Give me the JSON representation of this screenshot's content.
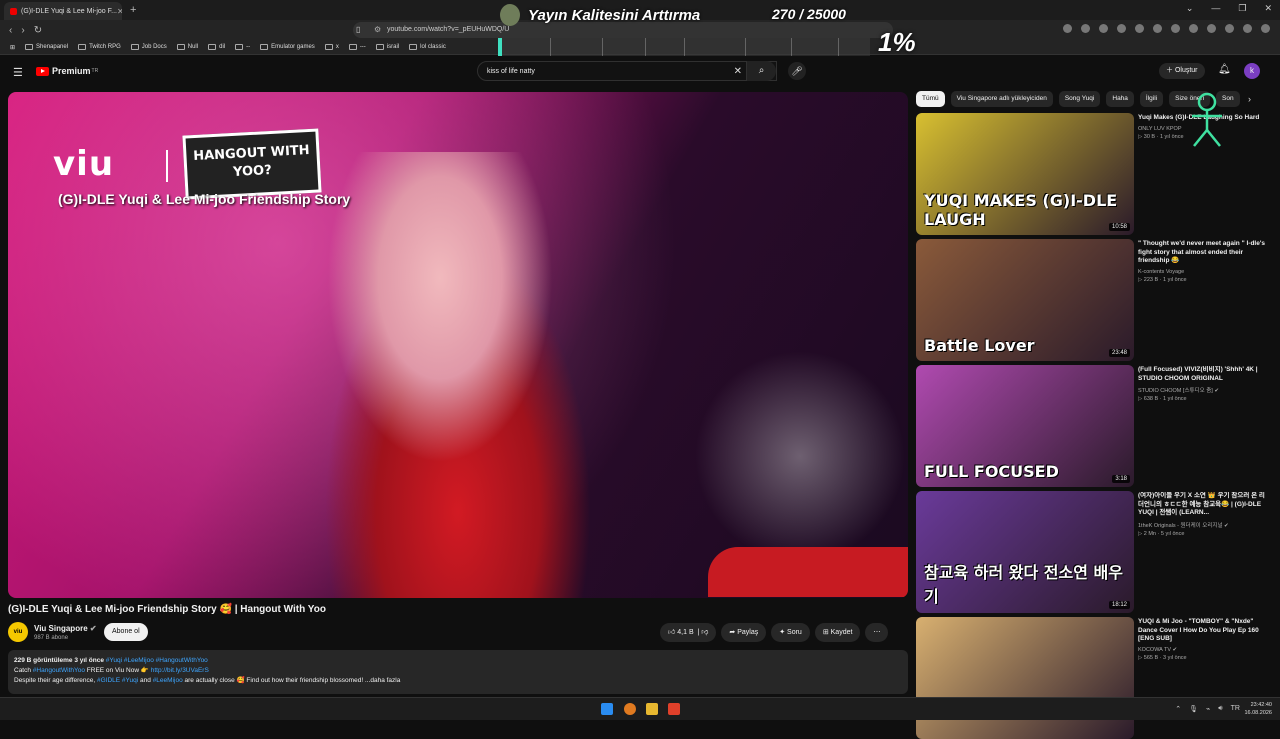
{
  "browser": {
    "tab_title": "(G)I-DLE Yuqi & Lee Mi-joo F...",
    "url": "youtube.com/watch?v=_pEUHuWDQ/U",
    "bookmarks": [
      "Shenapanel",
      "Twitch RPG",
      "Job Docs",
      "Null",
      "dil",
      "--",
      "Emulator games",
      "x",
      "---",
      "israil",
      "lol classic"
    ]
  },
  "stream_overlay": {
    "title": "Yayın Kalitesini Arttırma",
    "count": "270 / 25000",
    "percent": "1%",
    "progress": 0.01
  },
  "youtube": {
    "logo": "Premium",
    "logo_badge": "TR",
    "search_value": "kiss of life natty",
    "create_label": "Oluştur",
    "avatar_letter": "k"
  },
  "player": {
    "brand": "viu",
    "show_badge": "HANGOUT WITH YOO?",
    "overlay_text": "(G)I-DLE Yuqi & Lee Mi-joo Friendship Story"
  },
  "video": {
    "title": "(G)I-DLE Yuqi & Lee Mi-joo Friendship Story 🥰 | Hangout With Yoo",
    "channel": "Viu Singapore",
    "channel_avatar": "viu",
    "subs": "987 B abone",
    "subscribe": "Abone ol",
    "likes": "4,1 B",
    "share": "Paylaş",
    "ask": "Soru",
    "save": "Kaydet",
    "more": "⋯"
  },
  "description": {
    "views": "229 B görüntüleme  3 yıl önce",
    "tags": "#Yuqi #LeeMijoo #HangoutWithYoo",
    "line2_a": "Catch",
    "line2_tag": "#HangoutWithYoo",
    "line2_b": "FREE on Viu Now 👉",
    "line2_link": "http://bit.ly/3UVaErS",
    "line3_a": "Despite their age difference,",
    "line3_tags": "#GIDLE #Yuqi",
    "line3_b": "and",
    "line3_tag2": "#LeeMijoo",
    "line3_c": "are actually close 🥰 Find out how their friendship blossomed! ...daha fazla"
  },
  "chips": [
    "Tümü",
    "Viu Singapore adlı yükleyiciden",
    "Song Yuqi",
    "Haha",
    "İlgili",
    "Size öneri",
    "Son"
  ],
  "recommendations": [
    {
      "title": "Yuqi Makes (G)I-DLE Laughing So Hard",
      "channel": "ONLY LUV KPOP",
      "meta": "▷ 30 B · 1 yıl önce",
      "duration": "10:58",
      "thumb_text": "YUQI MAKES (G)I-DLE LAUGH",
      "color": "#d8c030"
    },
    {
      "title": "\" Thought we'd never meet again \" I-dle's fight story that almost ended their friendship 😂",
      "channel": "K-contents Voyage",
      "meta": "▷ 223 B · 1 yıl önce",
      "duration": "23:48",
      "thumb_text": "Battle Lover",
      "color": "#8a5a3a"
    },
    {
      "title": "(Full Focused) VIVIZ(비비지) 'Shhh' 4K | STUDIO CHOOM ORIGINAL",
      "channel": "STUDIO CHOOM [스튜디오 춤] ✔",
      "meta": "▷ 638 B · 1 yıl önce",
      "duration": "3:18",
      "thumb_text": "FULL FOCUSED",
      "color": "#b04ab0"
    },
    {
      "title": "(여자)아이들 우기 X 소연 👑 우기 참으러 온 리더언니의 ㅎㄷㄷ한 예능 참교육😂 | (G)I-DLE YUQI | 전쌤이 (LEARN...",
      "channel": "1theK Originals - 원더케이 오리지널 ✔",
      "meta": "▷ 2 Mn · 5 yıl önce",
      "duration": "18:12",
      "thumb_text": "참교육 하러 왔다 전소연 배우기",
      "color": "#6a3a9a"
    },
    {
      "title": "YUQI & Mi Joo - \"TOMBOY\" & \"Nxde\" Dance Cover l How Do You Play Ep 160 [ENG SUB]",
      "channel": "KOCOWA TV ✔",
      "meta": "▷ 565 B · 3 yıl önce",
      "duration": "",
      "thumb_text": "",
      "color": "#d8b070"
    }
  ],
  "taskbar": {
    "time": "23:42:40",
    "date": "16.08.2026"
  }
}
